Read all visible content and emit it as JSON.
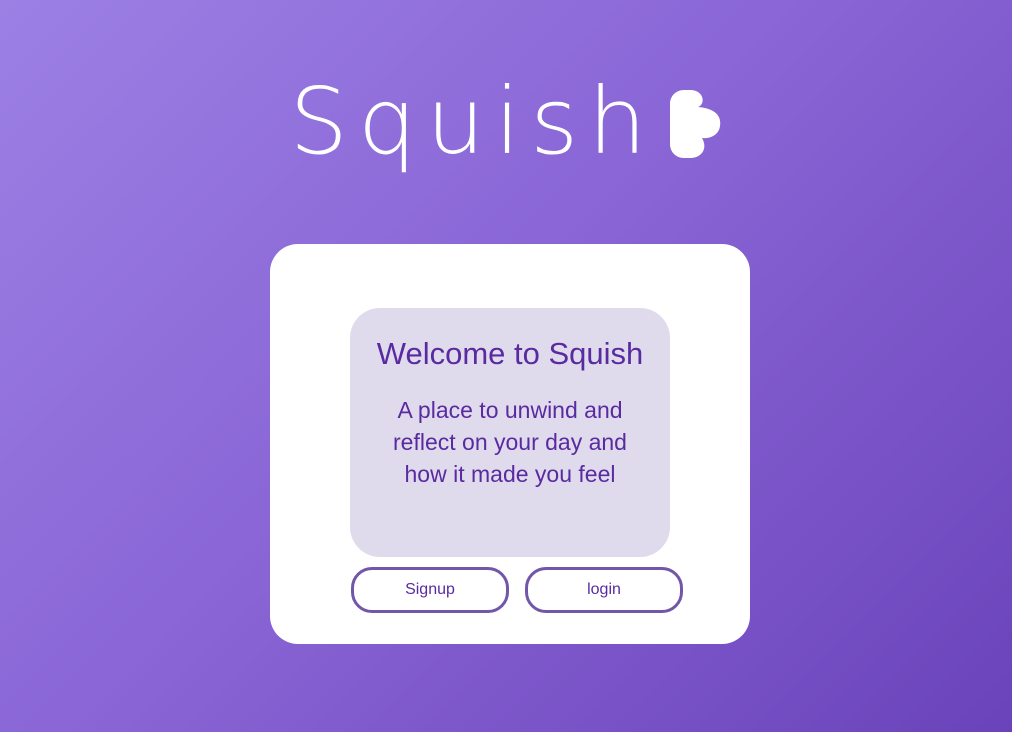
{
  "app": {
    "name": "Squish",
    "logo_icon": "squish-blob-icon",
    "colors": {
      "background_start": "#9c80e4",
      "background_end": "#6a43ba",
      "card": "#ffffff",
      "welcome_box": "#dfdbec",
      "text_purple": "#5a2aa0",
      "button_border": "#7256a8"
    }
  },
  "welcome": {
    "title": "Welcome to Squish",
    "subtitle": "A place to unwind and reflect on your day and how it made you feel"
  },
  "buttons": {
    "signup_label": "Signup",
    "login_label": "login"
  }
}
